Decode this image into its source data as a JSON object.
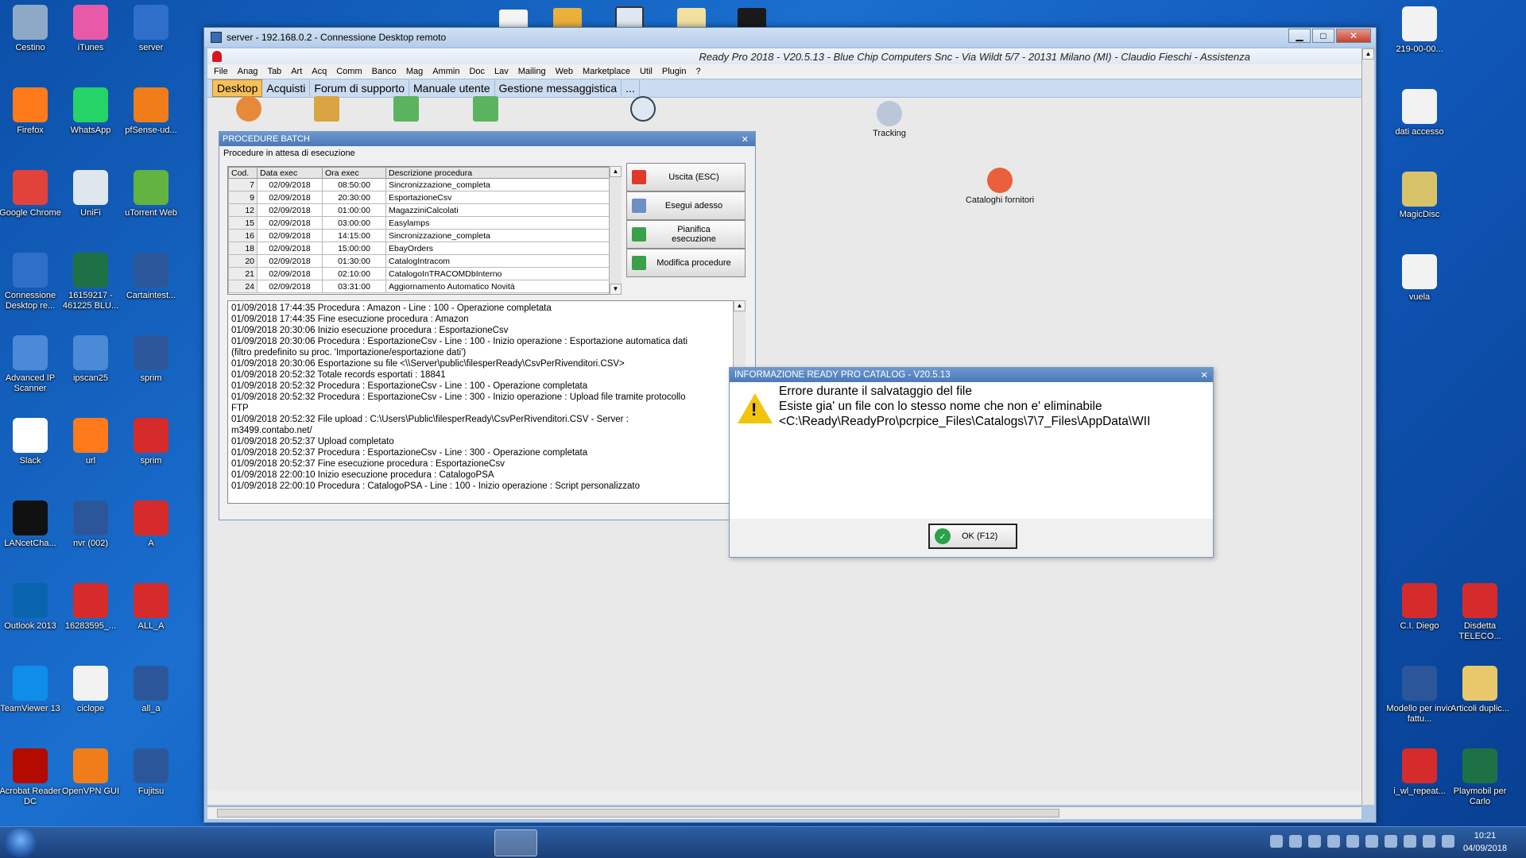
{
  "desktop_icons_left": [
    {
      "label": "Cestino",
      "icon": "recycle-bin-icon",
      "color": "#8ea9c8"
    },
    {
      "label": "iTunes",
      "icon": "itunes-icon",
      "color": "#e85aa8"
    },
    {
      "label": "server",
      "icon": "remote-desktop-icon",
      "color": "#2f6fc9"
    },
    {
      "label": "Firefox",
      "icon": "firefox-icon",
      "color": "#ff7a1a"
    },
    {
      "label": "WhatsApp",
      "icon": "whatsapp-icon",
      "color": "#25d366"
    },
    {
      "label": "pfSense-ud...",
      "icon": "openvpn-icon",
      "color": "#f07d1a"
    },
    {
      "label": "Google Chrome",
      "icon": "chrome-icon",
      "color": "#e1433b"
    },
    {
      "label": "UniFi",
      "icon": "unifi-icon",
      "color": "#dfe6ee"
    },
    {
      "label": "uTorrent Web",
      "icon": "utorrent-icon",
      "color": "#62b33f"
    },
    {
      "label": "Connessione Desktop re...",
      "icon": "remote-desktop-icon",
      "color": "#2f6fc9"
    },
    {
      "label": "16159217 - 461225 BLU...",
      "icon": "excel-icon",
      "color": "#1e7145"
    },
    {
      "label": "Cartaintest...",
      "icon": "word-icon",
      "color": "#2b579a"
    },
    {
      "label": "Advanced IP Scanner",
      "icon": "network-scanner-icon",
      "color": "#4b8ad6"
    },
    {
      "label": "ipscan25",
      "icon": "network-scanner-icon",
      "color": "#4b8ad6"
    },
    {
      "label": "sprim",
      "icon": "word-icon",
      "color": "#2b579a"
    },
    {
      "label": "Slack",
      "icon": "slack-icon",
      "color": "#ffffff"
    },
    {
      "label": "url",
      "icon": "firefox-doc-icon",
      "color": "#ff7a1a"
    },
    {
      "label": "sprim",
      "icon": "pdf-icon",
      "color": "#d62b2b"
    },
    {
      "label": "LANcetCha...",
      "icon": "lancet-icon",
      "color": "#111111"
    },
    {
      "label": "nvr (002)",
      "icon": "word-icon",
      "color": "#2b579a"
    },
    {
      "label": "A",
      "icon": "pdf-icon",
      "color": "#d62b2b"
    },
    {
      "label": "Outlook 2013",
      "icon": "outlook-icon",
      "color": "#0a64ad"
    },
    {
      "label": "16283595_...",
      "icon": "pdf-icon",
      "color": "#d62b2b"
    },
    {
      "label": "ALL_A",
      "icon": "pdf-icon",
      "color": "#d62b2b"
    },
    {
      "label": "TeamViewer 13",
      "icon": "teamviewer-icon",
      "color": "#0e8ee9"
    },
    {
      "label": "ciclope",
      "icon": "file-icon",
      "color": "#f2f2f2"
    },
    {
      "label": "all_a",
      "icon": "word-icon",
      "color": "#2b579a"
    },
    {
      "label": "Acrobat Reader DC",
      "icon": "acrobat-icon",
      "color": "#b30b00"
    },
    {
      "label": "OpenVPN GUI",
      "icon": "openvpn-icon",
      "color": "#f07d1a"
    },
    {
      "label": "Fujitsu",
      "icon": "word-icon",
      "color": "#2b579a"
    }
  ],
  "desktop_icons_right": [
    {
      "label": "219-00-00...",
      "icon": "file-icon",
      "color": "#f2f2f2"
    },
    {
      "label": "dati accesso",
      "icon": "file-icon",
      "color": "#f2f2f2"
    },
    {
      "label": "MagicDisc",
      "icon": "disc-icon",
      "color": "#d9c36a"
    },
    {
      "label": "vuela",
      "icon": "file-icon",
      "color": "#f2f2f2"
    },
    {
      "label": "C.I. Diego",
      "icon": "pdf-icon",
      "color": "#d62b2b"
    },
    {
      "label": "Disdetta TELECO...",
      "icon": "pdf-icon",
      "color": "#d62b2b"
    },
    {
      "label": "Modello per invio fattu...",
      "icon": "word-icon",
      "color": "#2b579a"
    },
    {
      "label": "Articoli duplic...",
      "icon": "folder-icon",
      "color": "#e8c86a"
    },
    {
      "label": "i_wl_repeat...",
      "icon": "pdf-icon",
      "color": "#d62b2b"
    },
    {
      "label": "Playmobil per Carlo",
      "icon": "excel-icon",
      "color": "#1e7145"
    }
  ],
  "rdp": {
    "title": "server - 192.168.0.2 - Connessione Desktop remoto",
    "minimize": "▁",
    "maximize": "□",
    "close": "✕"
  },
  "app": {
    "title": "Ready Pro 2018 - V20.5.13 - Blue Chip Computers Snc - Via Wildt 5/7 - 20131 Milano (MI) - Claudio Fieschi - Assistenza",
    "menu": [
      "File",
      "Anag",
      "Tab",
      "Art",
      "Acq",
      "Comm",
      "Banco",
      "Mag",
      "Ammin",
      "Doc",
      "Lav",
      "Mailing",
      "Web",
      "Marketplace",
      "Util",
      "Plugin",
      "?"
    ],
    "tabs": [
      "Desktop",
      "Acquisti",
      "Forum di supporto",
      "Manuale utente",
      "Gestione messaggistica",
      "..."
    ],
    "desk_items": [
      {
        "label": "Tracking"
      },
      {
        "label": "Cataloghi fornitori"
      }
    ]
  },
  "batch": {
    "title": "PROCEDURE BATCH",
    "subtitle": "Procedure in attesa di esecuzione",
    "columns": [
      "Cod.",
      "Data exec",
      "Ora exec",
      "Descrizione procedura"
    ],
    "rows": [
      [
        "7",
        "02/09/2018",
        "08:50:00",
        "Sincronizzazione_completa"
      ],
      [
        "9",
        "02/09/2018",
        "20:30:00",
        "EsportazioneCsv"
      ],
      [
        "12",
        "02/09/2018",
        "01:00:00",
        "MagazziniCalcolati"
      ],
      [
        "15",
        "02/09/2018",
        "03:00:00",
        "Easylamps"
      ],
      [
        "16",
        "02/09/2018",
        "14:15:00",
        "Sincronizzazione_completa"
      ],
      [
        "18",
        "02/09/2018",
        "15:00:00",
        "EbayOrders"
      ],
      [
        "20",
        "02/09/2018",
        "01:30:00",
        "CatalogIntracom"
      ],
      [
        "21",
        "02/09/2018",
        "02:10:00",
        "CatalogoInTRACOMDbInterno"
      ],
      [
        "24",
        "02/09/2018",
        "03:31:00",
        "Aggiornamento Automatico Novità"
      ]
    ],
    "buttons": [
      {
        "label": "Uscita (ESC)",
        "icon": "exit-icon",
        "color": "#e0392b"
      },
      {
        "label": "Esegui adesso",
        "icon": "execute-icon",
        "color": "#6c8fc4"
      },
      {
        "label": "Pianifica esecuzione",
        "icon": "schedule-icon",
        "color": "#3aa14a"
      },
      {
        "label": "Modifica procedure",
        "icon": "edit-icon",
        "color": "#3aa14a"
      }
    ],
    "log": [
      "01/09/2018 17:44:35 Procedura : Amazon - Line : 100 - Operazione completata",
      "01/09/2018 17:44:35 Fine esecuzione procedura : Amazon",
      "01/09/2018 20:30:06 Inizio esecuzione procedura : EsportazioneCsv",
      "01/09/2018 20:30:06 Procedura : EsportazioneCsv - Line : 100 - Inizio operazione : Esportazione automatica dati",
      "(filtro predefinito su proc. 'Importazione/esportazione dati')",
      "01/09/2018 20:30:06 Esportazione su file <\\\\Server\\public\\filesperReady\\CsvPerRivenditori.CSV>",
      "01/09/2018 20:52:32 Totale records esportati : 18841",
      "01/09/2018 20:52:32 Procedura : EsportazioneCsv - Line : 100 - Operazione completata",
      "01/09/2018 20:52:32 Procedura : EsportazioneCsv - Line : 300 - Inizio operazione : Upload file tramite protocollo",
      "FTP",
      "01/09/2018 20:52:32 File upload : C:\\Users\\Public\\filesperReady\\CsvPerRivenditori.CSV - Server :",
      "m3499.contabo.net/",
      "01/09/2018 20:52:37 Upload completato",
      "01/09/2018 20:52:37 Procedura : EsportazioneCsv - Line : 300 - Operazione completata",
      "01/09/2018 20:52:37 Fine esecuzione procedura : EsportazioneCsv",
      "01/09/2018 22:00:10 Inizio esecuzione procedura : CatalogoPSA",
      "01/09/2018 22:00:10 Procedura : CatalogoPSA - Line : 100 - Inizio operazione : Script personalizzato"
    ]
  },
  "dialog": {
    "title": "INFORMAZIONE READY PRO CATALOG - V20.5.13",
    "close": "✕",
    "line1": "Errore durante il salvataggio del file",
    "line2": "Esiste gia' un file con lo stesso nome che non e' eliminabile",
    "line3": "<C:\\Ready\\ReadyPro\\pcrpice_Files\\Catalogs\\7\\7_Files\\AppData\\WII",
    "ok_label": "OK (F12)"
  },
  "taskbar": {
    "time": "10:21",
    "date": "04/09/2018"
  }
}
